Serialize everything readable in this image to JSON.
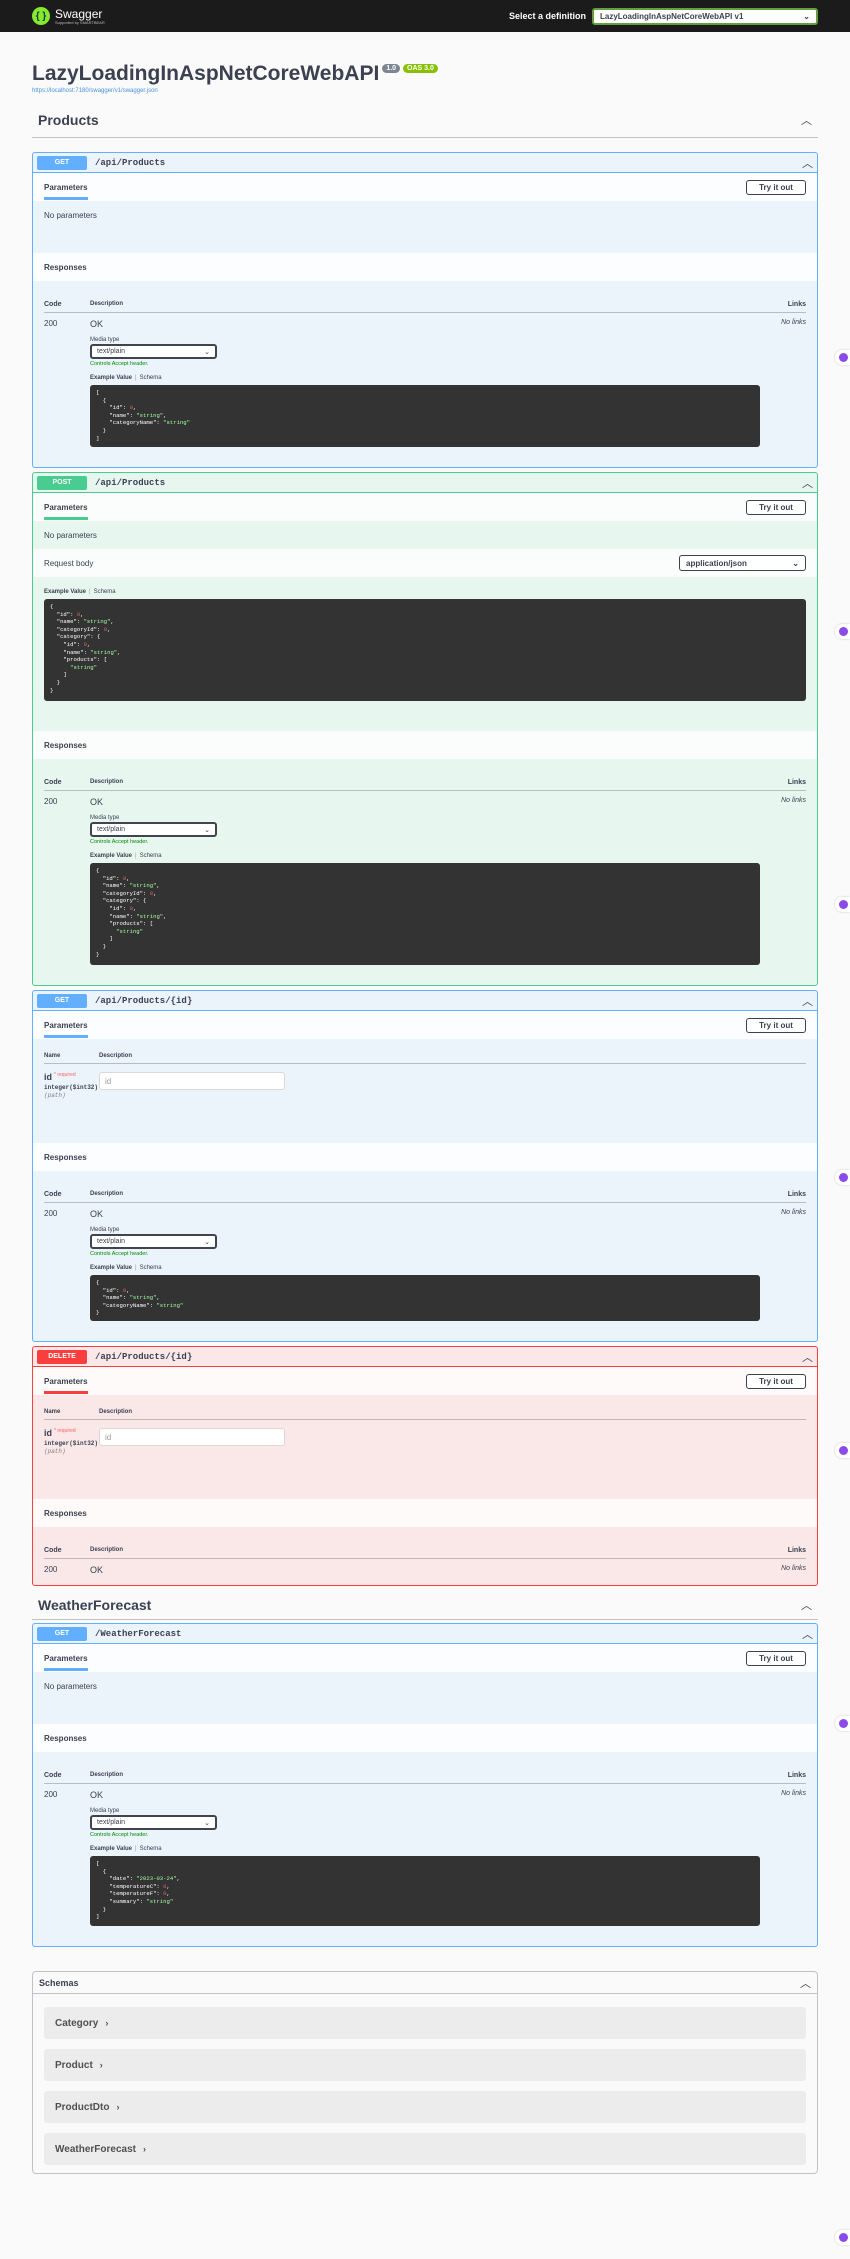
{
  "topbar": {
    "logo_name": "Swagger",
    "logo_sub": "Supported by SMARTBEAR",
    "select_label": "Select a definition",
    "selected_definition": "LazyLoadingInAspNetCoreWebAPI v1"
  },
  "info": {
    "title": "LazyLoadingInAspNetCoreWebAPI",
    "version": "1.0",
    "oas": "OAS 3.0",
    "url": "https://localhost:7180/swagger/v1/swagger.json"
  },
  "labels": {
    "parameters": "Parameters",
    "try_it_out": "Try it out",
    "no_parameters": "No parameters",
    "responses": "Responses",
    "code": "Code",
    "description": "Description",
    "links": "Links",
    "no_links": "No links",
    "media_type": "Media type",
    "controls": "Controls Accept header.",
    "example_value": "Example Value",
    "schema": "Schema",
    "request_body": "Request body",
    "name": "Name",
    "required": "* required",
    "ok": "OK",
    "code_200": "200",
    "text_plain": "text/plain",
    "app_json": "application/json"
  },
  "products": {
    "tag": "Products",
    "get_all": {
      "method": "GET",
      "path": "/api/Products"
    },
    "post": {
      "method": "POST",
      "path": "/api/Products"
    },
    "get_id": {
      "method": "GET",
      "path": "/api/Products/{id}"
    },
    "delete": {
      "method": "DELETE",
      "path": "/api/Products/{id}"
    },
    "param": {
      "name": "id",
      "type": "integer($int32)",
      "in": "(path)",
      "placeholder": "id"
    }
  },
  "weather": {
    "tag": "WeatherForecast",
    "get": {
      "method": "GET",
      "path": "/WeatherForecast"
    }
  },
  "schemas": {
    "title": "Schemas",
    "models": [
      "Category",
      "Product",
      "ProductDto",
      "WeatherForecast"
    ]
  }
}
